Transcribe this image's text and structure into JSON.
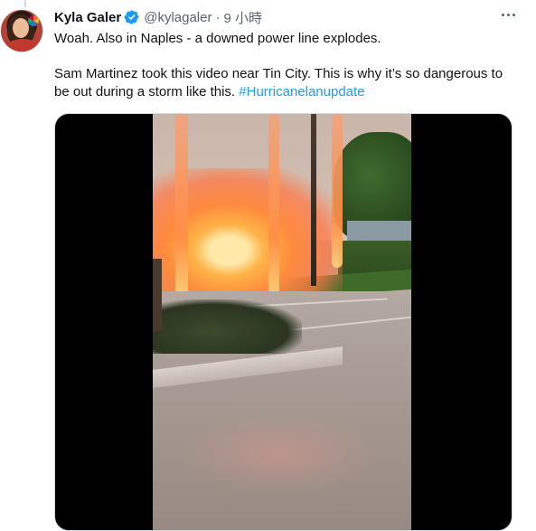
{
  "tweet": {
    "author": {
      "name": "Kyla Galer",
      "handle": "@kylagaler",
      "verified": true,
      "avatar_icon": "profile-photo"
    },
    "separator": "·",
    "timestamp": "9 小時",
    "more_icon": "more-options-icon",
    "text_line1": "Woah. Also in Naples - a downed power line explodes.",
    "text_line2": "Sam Martinez took this video near Tin City. This is why it’s so dangerous to",
    "text_line3_plain": "be out during a storm like this. ",
    "hashtag": "#Hurricanelanupdate",
    "media": {
      "type": "video",
      "subject": "downed-power-line-explosion"
    }
  },
  "colors": {
    "text": "#0f1419",
    "secondary_text": "#536471",
    "link": "#1d9bf0",
    "verified_badge": "#1d9bf0",
    "border": "#cfd9de",
    "media_letterbox": "#000000"
  }
}
